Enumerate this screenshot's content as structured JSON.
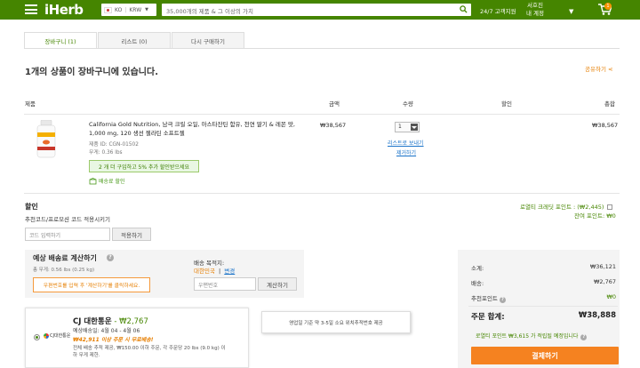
{
  "header": {
    "logo": "iHerb",
    "locale": "KO",
    "currency": "KRW",
    "search_placeholder": "35,000개의 제품 & 그 이상의 가치",
    "support": "24/7 고객지원",
    "greeting": "서호진",
    "account": "내 계정",
    "cart_count": "1",
    "colors": {
      "brand": "#458500",
      "accent": "#f58220"
    }
  },
  "tabs": [
    {
      "label": "장바구니 (1)",
      "active": true
    },
    {
      "label": "리스트 (0)",
      "active": false
    },
    {
      "label": "다시 구매하기",
      "active": false
    }
  ],
  "cart_title": "1개의 상품이 장바구니에 있습니다.",
  "share_label": "공유하기",
  "columns": {
    "product": "제품",
    "price": "금액",
    "qty": "수량",
    "discount": "할인",
    "total": "총합"
  },
  "item": {
    "name": "California Gold Nutrition, 남극 크릴 오일, 아스타잔틴 함유, 천연 딸기 & 레몬 맛, 1,000 mg, 120 생선 젤라틴 소프트젤",
    "product_id": "제품 ID: CGN-01502",
    "weight": "무게: 0.36 lbs",
    "bottle_label": "Antarctic Krill Oil",
    "promo": "2 개 더 구입하고 5% 추가 할인받으세요",
    "shipping_tag": "배송료 할인",
    "price": "₩38,567",
    "qty": "1",
    "move_to_list": "리스트로 보내기",
    "remove": "제거하기",
    "total": "₩38,567"
  },
  "discount": {
    "title": "할인",
    "subtitle": "추천코드/프로모션 코드 적용시키기",
    "code_placeholder": "코드 입력하기",
    "apply": "적용하기"
  },
  "rewards": {
    "loyalty": "로열티 크레딧 포인트 : (₩2,445)",
    "balance": "잔여 포인트: ₩0"
  },
  "shipping_calc": {
    "title": "예상 배송료 계산하기",
    "weight": "총 무게: 0.56 lbs (0.25 kg)",
    "warning": "우편번호를 입력 후 '계산하기'를 클릭하세요.",
    "dest_label": "배송 목적지:",
    "dest_country": "대한민국",
    "dest_sep": "|",
    "dest_change": "변경",
    "zip_placeholder": "우편번호",
    "calc_button": "계산하기"
  },
  "carrier": {
    "name": "CJ 대한통운",
    "sep": " - ",
    "price": "₩2,767",
    "logo_text": "CJ대한통운",
    "eta": "예상배송일: 4월 04 - 4월 06",
    "free": "₩42,911 이상 주문 시 무료배송!",
    "detail1": "전체 배송 추적 제공, ₩150.00 이하 주문, 각 주문당 20 lbs (9.0 kg) 이",
    "detail2": "하 무게 제한."
  },
  "note": "영업일 기준 약 3-5일 소요 위치추적번호 제공",
  "summary": {
    "subtotal_label": "소계:",
    "subtotal": "₩36,121",
    "shipping_label": "배송:",
    "shipping": "₩2,767",
    "referral_label": "추천포인트",
    "referral": "₩0",
    "total_label": "주문 합계:",
    "total": "₩38,888",
    "loyalty_note": "로열티 포인트 ₩3,615 가 적립될 예정입니다",
    "checkout": "결제하기"
  }
}
